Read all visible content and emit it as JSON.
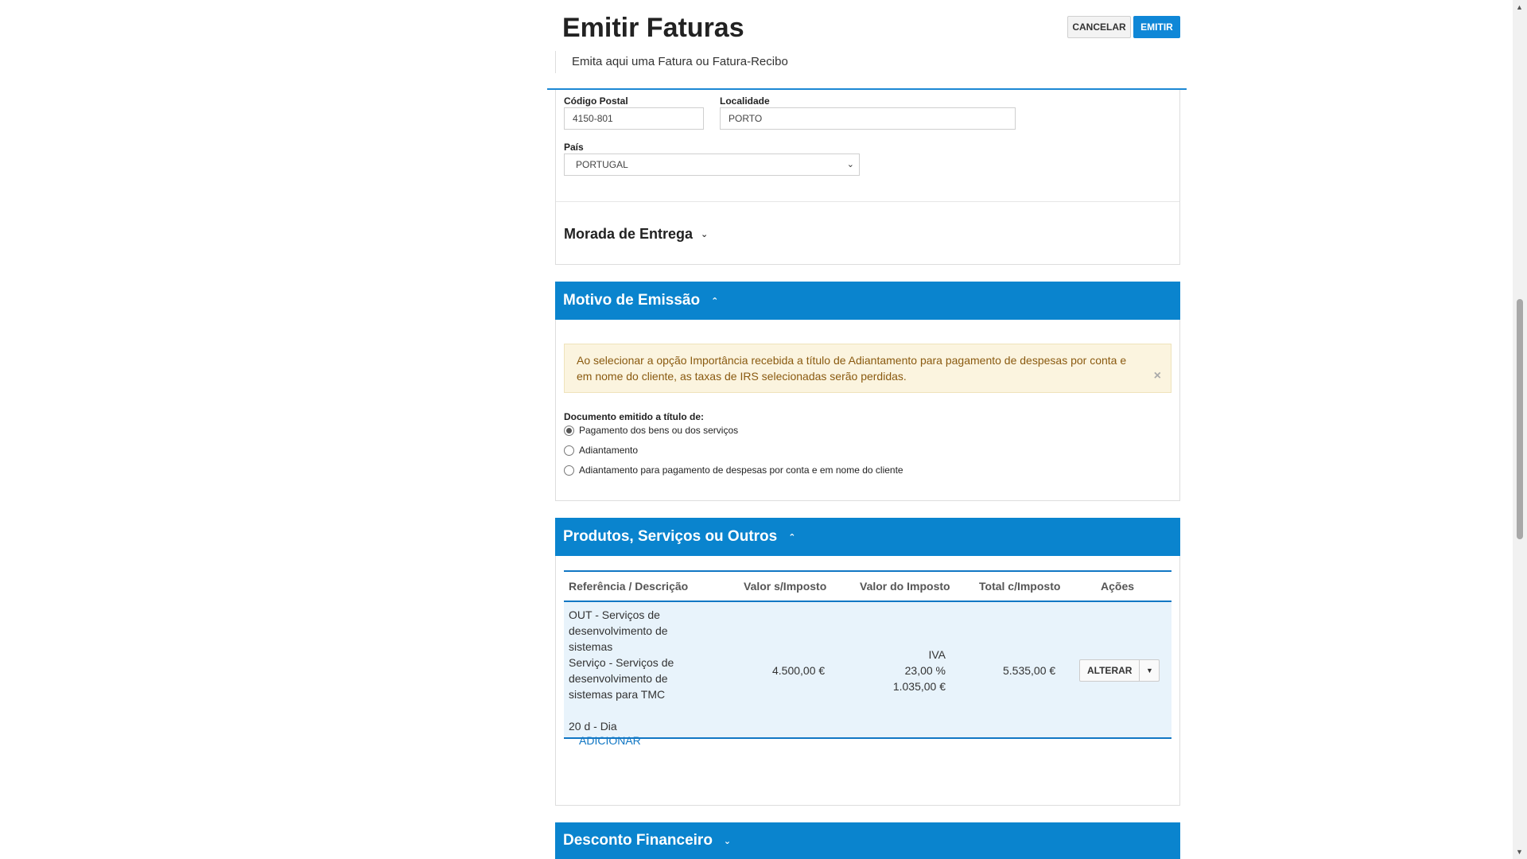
{
  "header": {
    "title": "Emitir Faturas",
    "subtitle": "Emita aqui uma Fatura ou Fatura-Recibo",
    "cancel_label": "CANCELAR",
    "emit_label": "EMITIR"
  },
  "address": {
    "postal_code_label": "Código Postal",
    "postal_code_value": "4150-801",
    "locality_label": "Localidade",
    "locality_value": "PORTO",
    "country_label": "País",
    "country_value": "PORTUGAL",
    "delivery_title": "Morada de Entrega"
  },
  "motivo": {
    "title": "Motivo de Emissão",
    "alert_text": "Ao selecionar a opção Importância recebida a título de Adiantamento para pagamento de despesas por conta e em nome do cliente, as taxas de IRS selecionadas serão perdidas.",
    "alert_close": "×",
    "group_label": "Documento emitido a título de:",
    "options": [
      {
        "label": "Pagamento dos bens ou dos serviços",
        "checked": true
      },
      {
        "label": "Adiantamento",
        "checked": false
      },
      {
        "label": "Adiantamento para pagamento de despesas por conta e em nome do cliente",
        "checked": false
      }
    ]
  },
  "produtos": {
    "title": "Produtos, Serviços ou Outros",
    "columns": [
      "Referência / Descrição",
      "Valor s/Imposto",
      "Valor do Imposto",
      "Total c/Imposto",
      "Ações"
    ],
    "rows": [
      {
        "desc_line1": "OUT - Serviços de",
        "desc_line2": "desenvolvimento de",
        "desc_line3": "sistemas",
        "desc_line4": "Serviço - Serviços de",
        "desc_line5": "desenvolvimento de",
        "desc_line6": "sistemas para TMC",
        "quantity": "20 d - Dia",
        "valor_s_imposto": "4.500,00 €",
        "tax_type": "IVA",
        "tax_rate": "23,00 %",
        "tax_value": "1.035,00 €",
        "total": "5.535,00 €",
        "action_label": "ALTERAR"
      }
    ],
    "add_label": "ADICIONAR"
  },
  "desconto": {
    "title": "Desconto Financeiro"
  },
  "icons": {
    "chevron_down": "⌄",
    "chevron_up": "⌃",
    "caret_down": "▼",
    "scroll_up": "▲",
    "scroll_down": "▼"
  }
}
